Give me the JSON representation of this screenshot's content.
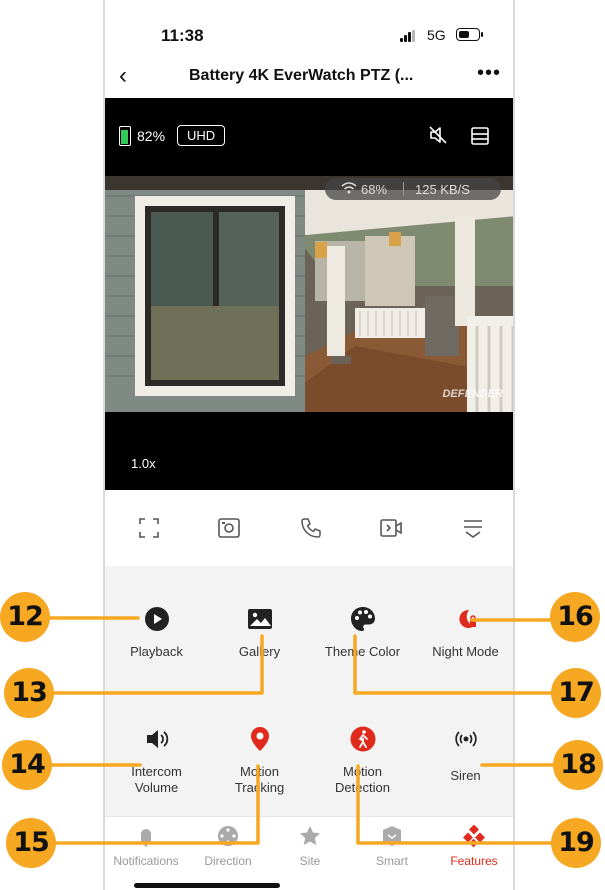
{
  "status_bar": {
    "time": "11:38",
    "network": "5G"
  },
  "nav": {
    "title": "Battery 4K EverWatch PTZ (...",
    "back_icon": "chevron-left-icon",
    "more_icon": "ellipsis-icon"
  },
  "video": {
    "battery_level": "82%",
    "quality_badge": "UHD",
    "wifi_strength": "68%",
    "bitrate": "125 KB/S",
    "watermark": "DEFENDER",
    "zoom_level": "1.0x"
  },
  "controls": [
    {
      "name": "fullscreen",
      "icon": "fullscreen-icon"
    },
    {
      "name": "screenshot",
      "icon": "camera-icon"
    },
    {
      "name": "talk",
      "icon": "phone-icon"
    },
    {
      "name": "record",
      "icon": "video-record-icon"
    },
    {
      "name": "more-controls",
      "icon": "collapse-menu-icon"
    }
  ],
  "features": {
    "playback": "Playback",
    "gallery": "Gallery",
    "theme_color": "Theme Color",
    "night_mode": "Night Mode",
    "intercom_line1": "Intercom",
    "intercom_line2": "Volume",
    "motion_tracking_line1": "Motion",
    "motion_tracking_line2": "Tracking",
    "motion_detection_line1": "Motion",
    "motion_detection_line2": "Detection",
    "siren": "Siren"
  },
  "tabs": {
    "notifications": "Notifications",
    "direction": "Direction",
    "site": "Site",
    "smart": "Smart",
    "features": "Features",
    "active": "Features"
  },
  "callouts": [
    "12",
    "13",
    "14",
    "15",
    "16",
    "17",
    "18",
    "19"
  ],
  "colors": {
    "accent_red": "#e02a1b",
    "callout_orange": "#f7a823",
    "battery_green": "#34c759"
  }
}
